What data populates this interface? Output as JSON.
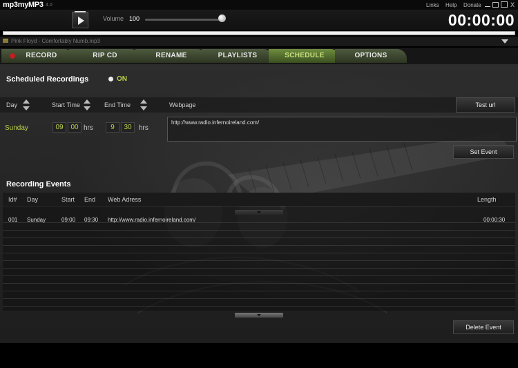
{
  "app": {
    "logo": "mp3myMP3",
    "version": "4.0",
    "links": [
      "Links",
      "Help",
      "Donate"
    ],
    "window_buttons": [
      "minimize-icon",
      "restore-icon",
      "maximize-icon",
      "close-icon"
    ],
    "close_glyph": "X"
  },
  "player": {
    "volume_label": "Volume",
    "volume_value": "100",
    "volume_level": 1.0,
    "time": "00:00:00",
    "track_name": "Pink Floyd - Comfortably Numb.mp3",
    "progress": 1.0
  },
  "tabs": [
    {
      "label": "RECORD",
      "active": false
    },
    {
      "label": "RIP CD",
      "active": false
    },
    {
      "label": "RENAME",
      "active": false
    },
    {
      "label": "PLAYLISTS",
      "active": false
    },
    {
      "label": "SCHEDULE",
      "active": true
    },
    {
      "label": "OPTIONS",
      "active": false
    }
  ],
  "schedule": {
    "title": "Scheduled Recordings",
    "status": "ON",
    "headers": {
      "day": "Day",
      "start": "Start Time",
      "end": "End Time",
      "webpage": "Webpage"
    },
    "test_url_button": "Test url",
    "set_event_button": "Set Event",
    "day": "Sunday",
    "start_hour": "09",
    "start_min": "00",
    "end_hour": "9",
    "end_min": "30",
    "hrs_label": "hrs",
    "webpage": "http://www.radio.infernoireland.com/"
  },
  "events": {
    "title": "Recording Events",
    "columns": {
      "id": "Id#",
      "day": "Day",
      "start": "Start",
      "end": "End",
      "web": "Web Adress",
      "length": "Length"
    },
    "rows": [
      {
        "id": "001",
        "day": "Sunday",
        "start": "09:00",
        "end": "09:30",
        "web": "http://www.radio.infernoireland.com/",
        "length": "00:00:30"
      }
    ],
    "delete_button": "Delete Event"
  },
  "colors": {
    "accent_green": "#b9d34a",
    "tab_active": "#6e8c3e",
    "record_dot": "#b22222"
  }
}
